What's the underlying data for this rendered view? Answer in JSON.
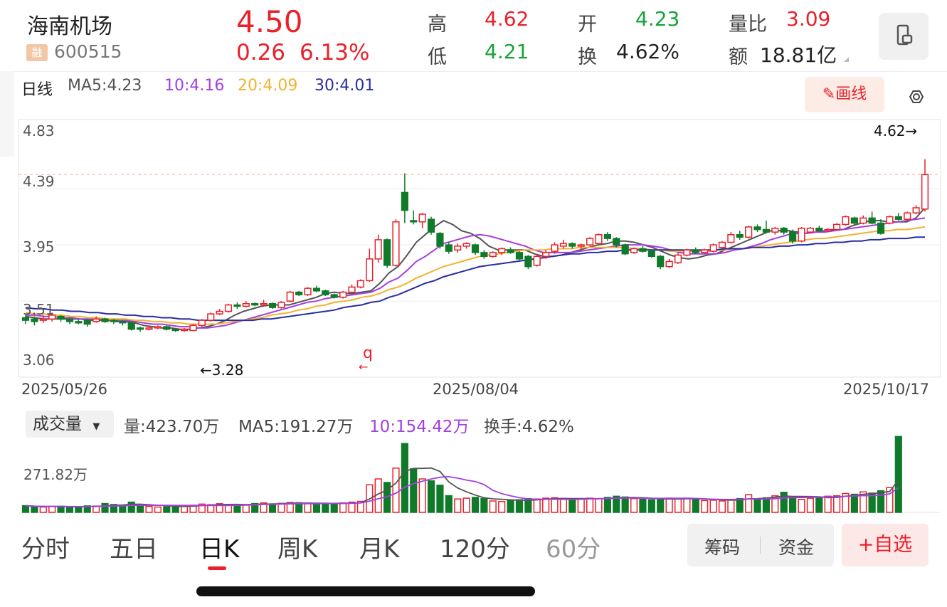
{
  "stock": {
    "name": "海南机场",
    "badge": "融",
    "code": "600515",
    "price": "4.50",
    "change": "0.26",
    "change_pct": "6.13%"
  },
  "quote": {
    "high_label": "高",
    "high": "4.62",
    "low_label": "低",
    "low": "4.21",
    "open_label": "开",
    "open": "4.23",
    "turnover_label": "换",
    "turnover": "4.62%",
    "vol_ratio_label": "量比",
    "vol_ratio": "3.09",
    "amount_label": "额",
    "amount": "18.81亿"
  },
  "ma": {
    "period": "日线",
    "ma5": "MA5:4.23",
    "ma10": "10:4.16",
    "ma20": "20:4.09",
    "ma30": "30:4.01",
    "colors": {
      "ma5": "#555555",
      "ma10": "#a43fe0",
      "ma20": "#f2b330",
      "ma30": "#2a2ea0"
    }
  },
  "draw_button": "画线",
  "price_axis": [
    "4.83",
    "4.39",
    "3.95",
    "3.51",
    "3.06"
  ],
  "annotations": {
    "max_label": "4.62→",
    "min_label": "←3.28",
    "q_marker": "q"
  },
  "dates": [
    "2025/05/26",
    "2025/08/04",
    "2025/10/17"
  ],
  "volume": {
    "selector": "成交量",
    "amount": "量:423.70万",
    "ma5": "MA5:191.27万",
    "ma10": "10:154.42万",
    "turnover": "换手:4.62%",
    "axis_label": "271.82万"
  },
  "tabs": [
    "分时",
    "五日",
    "日K",
    "周K",
    "月K",
    "120分",
    "60分"
  ],
  "buttons": {
    "chips": "筹码",
    "funds": "资金",
    "watchlist": "+自选"
  },
  "chart_data": {
    "type": "candlestick",
    "ylim": [
      3.06,
      4.83
    ],
    "x_ticks": [
      "2025/05/26",
      "2025/08/04",
      "2025/10/17"
    ],
    "candles": [
      {
        "o": 3.38,
        "c": 3.36,
        "h": 3.4,
        "l": 3.33
      },
      {
        "o": 3.37,
        "c": 3.35,
        "h": 3.39,
        "l": 3.32
      },
      {
        "o": 3.36,
        "c": 3.37,
        "h": 3.4,
        "l": 3.34
      },
      {
        "o": 3.37,
        "c": 3.4,
        "h": 3.42,
        "l": 3.35
      },
      {
        "o": 3.39,
        "c": 3.37,
        "h": 3.4,
        "l": 3.35
      },
      {
        "o": 3.37,
        "c": 3.35,
        "h": 3.38,
        "l": 3.33
      },
      {
        "o": 3.35,
        "c": 3.34,
        "h": 3.37,
        "l": 3.33
      },
      {
        "o": 3.36,
        "c": 3.33,
        "h": 3.37,
        "l": 3.31
      },
      {
        "o": 3.35,
        "c": 3.37,
        "h": 3.39,
        "l": 3.34
      },
      {
        "o": 3.37,
        "c": 3.35,
        "h": 3.38,
        "l": 3.34
      },
      {
        "o": 3.36,
        "c": 3.35,
        "h": 3.37,
        "l": 3.33
      },
      {
        "o": 3.35,
        "c": 3.34,
        "h": 3.36,
        "l": 3.32
      },
      {
        "o": 3.34,
        "c": 3.29,
        "h": 3.35,
        "l": 3.28
      },
      {
        "o": 3.3,
        "c": 3.29,
        "h": 3.31,
        "l": 3.27
      },
      {
        "o": 3.29,
        "c": 3.3,
        "h": 3.31,
        "l": 3.28
      },
      {
        "o": 3.3,
        "c": 3.31,
        "h": 3.32,
        "l": 3.29
      },
      {
        "o": 3.31,
        "c": 3.29,
        "h": 3.32,
        "l": 3.28
      },
      {
        "o": 3.29,
        "c": 3.28,
        "h": 3.3,
        "l": 3.27
      },
      {
        "o": 3.28,
        "c": 3.29,
        "h": 3.3,
        "l": 3.27
      },
      {
        "o": 3.28,
        "c": 3.32,
        "h": 3.33,
        "l": 3.28
      },
      {
        "o": 3.32,
        "c": 3.36,
        "h": 3.37,
        "l": 3.31
      },
      {
        "o": 3.36,
        "c": 3.41,
        "h": 3.42,
        "l": 3.35
      },
      {
        "o": 3.41,
        "c": 3.43,
        "h": 3.45,
        "l": 3.4
      },
      {
        "o": 3.43,
        "c": 3.48,
        "h": 3.49,
        "l": 3.42
      },
      {
        "o": 3.48,
        "c": 3.47,
        "h": 3.5,
        "l": 3.45
      },
      {
        "o": 3.47,
        "c": 3.49,
        "h": 3.51,
        "l": 3.46
      },
      {
        "o": 3.49,
        "c": 3.48,
        "h": 3.5,
        "l": 3.47
      },
      {
        "o": 3.48,
        "c": 3.49,
        "h": 3.52,
        "l": 3.47
      },
      {
        "o": 3.49,
        "c": 3.46,
        "h": 3.5,
        "l": 3.45
      },
      {
        "o": 3.46,
        "c": 3.5,
        "h": 3.51,
        "l": 3.45
      },
      {
        "o": 3.51,
        "c": 3.58,
        "h": 3.59,
        "l": 3.5
      },
      {
        "o": 3.58,
        "c": 3.56,
        "h": 3.59,
        "l": 3.55
      },
      {
        "o": 3.56,
        "c": 3.61,
        "h": 3.62,
        "l": 3.55
      },
      {
        "o": 3.61,
        "c": 3.59,
        "h": 3.63,
        "l": 3.58
      },
      {
        "o": 3.59,
        "c": 3.56,
        "h": 3.6,
        "l": 3.55
      },
      {
        "o": 3.56,
        "c": 3.54,
        "h": 3.57,
        "l": 3.53
      },
      {
        "o": 3.54,
        "c": 3.58,
        "h": 3.59,
        "l": 3.53
      },
      {
        "o": 3.58,
        "c": 3.62,
        "h": 3.64,
        "l": 3.57
      },
      {
        "o": 3.62,
        "c": 3.67,
        "h": 3.68,
        "l": 3.61
      },
      {
        "o": 3.67,
        "c": 3.84,
        "h": 3.92,
        "l": 3.66
      },
      {
        "o": 3.84,
        "c": 3.99,
        "h": 4.03,
        "l": 3.81
      },
      {
        "o": 3.99,
        "c": 3.79,
        "h": 4.0,
        "l": 3.77
      },
      {
        "o": 3.79,
        "c": 4.13,
        "h": 4.15,
        "l": 3.78
      },
      {
        "o": 4.36,
        "c": 4.22,
        "h": 4.51,
        "l": 4.12
      },
      {
        "o": 4.14,
        "c": 4.13,
        "h": 4.22,
        "l": 4.11
      },
      {
        "o": 4.13,
        "c": 4.19,
        "h": 4.2,
        "l": 4.08
      },
      {
        "o": 4.15,
        "c": 4.05,
        "h": 4.17,
        "l": 4.03
      },
      {
        "o": 4.04,
        "c": 3.94,
        "h": 4.05,
        "l": 3.92
      },
      {
        "o": 3.95,
        "c": 3.9,
        "h": 3.97,
        "l": 3.88
      },
      {
        "o": 3.91,
        "c": 3.94,
        "h": 3.96,
        "l": 3.89
      },
      {
        "o": 3.94,
        "c": 3.96,
        "h": 3.97,
        "l": 3.92
      },
      {
        "o": 3.95,
        "c": 3.89,
        "h": 3.96,
        "l": 3.87
      },
      {
        "o": 3.89,
        "c": 3.86,
        "h": 3.91,
        "l": 3.84
      },
      {
        "o": 3.86,
        "c": 3.89,
        "h": 3.9,
        "l": 3.85
      },
      {
        "o": 3.89,
        "c": 3.92,
        "h": 3.93,
        "l": 3.87
      },
      {
        "o": 3.91,
        "c": 3.89,
        "h": 3.93,
        "l": 3.88
      },
      {
        "o": 3.89,
        "c": 3.84,
        "h": 3.9,
        "l": 3.83
      },
      {
        "o": 3.86,
        "c": 3.78,
        "h": 3.87,
        "l": 3.76
      },
      {
        "o": 3.79,
        "c": 3.86,
        "h": 3.88,
        "l": 3.78
      },
      {
        "o": 3.86,
        "c": 3.89,
        "h": 3.91,
        "l": 3.84
      },
      {
        "o": 3.9,
        "c": 3.95,
        "h": 3.97,
        "l": 3.88
      },
      {
        "o": 3.94,
        "c": 3.96,
        "h": 3.99,
        "l": 3.92
      },
      {
        "o": 3.96,
        "c": 3.94,
        "h": 3.97,
        "l": 3.92
      },
      {
        "o": 3.94,
        "c": 3.95,
        "h": 3.96,
        "l": 3.91
      },
      {
        "o": 3.95,
        "c": 4.0,
        "h": 4.01,
        "l": 3.94
      },
      {
        "o": 3.96,
        "c": 4.03,
        "h": 4.04,
        "l": 3.95
      },
      {
        "o": 4.03,
        "c": 4.0,
        "h": 4.05,
        "l": 3.98
      },
      {
        "o": 4.0,
        "c": 3.95,
        "h": 4.01,
        "l": 3.93
      },
      {
        "o": 3.95,
        "c": 3.88,
        "h": 3.96,
        "l": 3.87
      },
      {
        "o": 3.89,
        "c": 3.92,
        "h": 3.93,
        "l": 3.88
      },
      {
        "o": 3.92,
        "c": 3.9,
        "h": 3.94,
        "l": 3.89
      },
      {
        "o": 3.9,
        "c": 3.86,
        "h": 3.91,
        "l": 3.85
      },
      {
        "o": 3.86,
        "c": 3.78,
        "h": 3.87,
        "l": 3.76
      },
      {
        "o": 3.78,
        "c": 3.82,
        "h": 3.84,
        "l": 3.77
      },
      {
        "o": 3.81,
        "c": 3.87,
        "h": 3.89,
        "l": 3.8
      },
      {
        "o": 3.87,
        "c": 3.91,
        "h": 3.92,
        "l": 3.86
      },
      {
        "o": 3.91,
        "c": 3.89,
        "h": 3.93,
        "l": 3.88
      },
      {
        "o": 3.89,
        "c": 3.91,
        "h": 3.92,
        "l": 3.88
      },
      {
        "o": 3.9,
        "c": 3.95,
        "h": 3.96,
        "l": 3.89
      },
      {
        "o": 3.93,
        "c": 3.97,
        "h": 3.98,
        "l": 3.92
      },
      {
        "o": 3.97,
        "c": 4.03,
        "h": 4.05,
        "l": 3.96
      },
      {
        "o": 4.03,
        "c": 4.01,
        "h": 4.06,
        "l": 3.99
      },
      {
        "o": 4.01,
        "c": 4.09,
        "h": 4.1,
        "l": 4.0
      },
      {
        "o": 4.09,
        "c": 4.07,
        "h": 4.11,
        "l": 4.05
      },
      {
        "o": 4.07,
        "c": 4.05,
        "h": 4.14,
        "l": 4.04
      },
      {
        "o": 4.05,
        "c": 4.08,
        "h": 4.09,
        "l": 4.03
      },
      {
        "o": 4.08,
        "c": 4.05,
        "h": 4.09,
        "l": 4.03
      },
      {
        "o": 4.05,
        "c": 3.98,
        "h": 4.07,
        "l": 3.96
      },
      {
        "o": 3.98,
        "c": 4.08,
        "h": 4.09,
        "l": 3.97
      },
      {
        "o": 4.05,
        "c": 4.08,
        "h": 4.09,
        "l": 4.04
      },
      {
        "o": 4.08,
        "c": 4.06,
        "h": 4.1,
        "l": 4.05
      },
      {
        "o": 4.06,
        "c": 4.07,
        "h": 4.08,
        "l": 4.05
      },
      {
        "o": 4.07,
        "c": 4.11,
        "h": 4.12,
        "l": 4.06
      },
      {
        "o": 4.11,
        "c": 4.17,
        "h": 4.18,
        "l": 4.1
      },
      {
        "o": 4.16,
        "c": 4.12,
        "h": 4.17,
        "l": 4.1
      },
      {
        "o": 4.12,
        "c": 4.16,
        "h": 4.18,
        "l": 4.11
      },
      {
        "o": 4.16,
        "c": 4.12,
        "h": 4.21,
        "l": 4.11
      },
      {
        "o": 4.12,
        "c": 4.04,
        "h": 4.15,
        "l": 4.03
      },
      {
        "o": 4.12,
        "c": 4.17,
        "h": 4.18,
        "l": 4.11
      },
      {
        "o": 4.17,
        "c": 4.15,
        "h": 4.2,
        "l": 4.14
      },
      {
        "o": 4.15,
        "c": 4.2,
        "h": 4.21,
        "l": 4.14
      },
      {
        "o": 4.2,
        "c": 4.24,
        "h": 4.26,
        "l": 4.19
      },
      {
        "o": 4.23,
        "c": 4.5,
        "h": 4.62,
        "l": 4.21
      }
    ],
    "ma_series": {
      "MA5": [
        3.39,
        3.38,
        3.37,
        3.37,
        3.37,
        3.37,
        3.37,
        3.36,
        3.36,
        3.36,
        3.35,
        3.35,
        3.34,
        3.32,
        3.31,
        3.3,
        3.3,
        3.29,
        3.29,
        3.3,
        3.31,
        3.33,
        3.36,
        3.4,
        3.43,
        3.45,
        3.47,
        3.48,
        3.48,
        3.48,
        3.5,
        3.52,
        3.54,
        3.57,
        3.58,
        3.57,
        3.57,
        3.58,
        3.59,
        3.65,
        3.73,
        3.78,
        3.87,
        3.97,
        4.03,
        4.09,
        4.14,
        4.11,
        4.06,
        4.04,
        4.0,
        3.94,
        3.91,
        3.91,
        3.91,
        3.91,
        3.88,
        3.86,
        3.86,
        3.87,
        3.89,
        3.91,
        3.93,
        3.95,
        3.96,
        3.98,
        3.98,
        3.97,
        3.95,
        3.93,
        3.9,
        3.87,
        3.85,
        3.84,
        3.85,
        3.87,
        3.88,
        3.91,
        3.94,
        3.97,
        4.0,
        4.03,
        4.06,
        4.06,
        4.06,
        4.05,
        4.04,
        4.05,
        4.06,
        4.07,
        4.07,
        4.1,
        4.12,
        4.14,
        4.14,
        4.13,
        4.13,
        4.13,
        4.16,
        4.24
      ],
      "MA10": [
        3.4,
        3.4,
        3.39,
        3.39,
        3.38,
        3.38,
        3.37,
        3.37,
        3.37,
        3.36,
        3.36,
        3.36,
        3.35,
        3.34,
        3.33,
        3.33,
        3.32,
        3.31,
        3.31,
        3.3,
        3.3,
        3.31,
        3.32,
        3.34,
        3.36,
        3.38,
        3.4,
        3.42,
        3.44,
        3.46,
        3.48,
        3.5,
        3.51,
        3.53,
        3.54,
        3.55,
        3.56,
        3.57,
        3.58,
        3.61,
        3.66,
        3.69,
        3.75,
        3.82,
        3.86,
        3.91,
        3.96,
        3.98,
        4.0,
        4.02,
        4.03,
        4.02,
        4.0,
        3.98,
        3.96,
        3.94,
        3.91,
        3.89,
        3.89,
        3.89,
        3.89,
        3.9,
        3.91,
        3.92,
        3.93,
        3.94,
        3.95,
        3.95,
        3.95,
        3.94,
        3.93,
        3.91,
        3.89,
        3.88,
        3.88,
        3.88,
        3.88,
        3.89,
        3.91,
        3.92,
        3.94,
        3.96,
        3.99,
        4.01,
        4.03,
        4.04,
        4.04,
        4.05,
        4.05,
        4.06,
        4.07,
        4.08,
        4.09,
        4.1,
        4.11,
        4.12,
        4.13,
        4.14,
        4.15,
        4.16
      ],
      "MA20": [
        3.42,
        3.41,
        3.41,
        3.4,
        3.4,
        3.39,
        3.39,
        3.38,
        3.38,
        3.37,
        3.37,
        3.37,
        3.36,
        3.36,
        3.35,
        3.35,
        3.34,
        3.34,
        3.33,
        3.33,
        3.33,
        3.33,
        3.34,
        3.35,
        3.36,
        3.37,
        3.38,
        3.4,
        3.41,
        3.42,
        3.44,
        3.45,
        3.47,
        3.48,
        3.5,
        3.51,
        3.52,
        3.54,
        3.55,
        3.57,
        3.6,
        3.62,
        3.65,
        3.69,
        3.72,
        3.75,
        3.78,
        3.8,
        3.82,
        3.84,
        3.86,
        3.87,
        3.88,
        3.89,
        3.9,
        3.91,
        3.91,
        3.91,
        3.92,
        3.92,
        3.92,
        3.93,
        3.93,
        3.93,
        3.93,
        3.93,
        3.93,
        3.92,
        3.92,
        3.91,
        3.91,
        3.9,
        3.9,
        3.9,
        3.9,
        3.9,
        3.91,
        3.91,
        3.92,
        3.92,
        3.93,
        3.94,
        3.95,
        3.96,
        3.97,
        3.98,
        3.99,
        4.0,
        4.0,
        4.01,
        4.02,
        4.03,
        4.04,
        4.05,
        4.06,
        4.06,
        4.07,
        4.07,
        4.08,
        4.09
      ],
      "MA30": [
        3.46,
        3.45,
        3.45,
        3.44,
        3.44,
        3.43,
        3.43,
        3.42,
        3.42,
        3.41,
        3.41,
        3.4,
        3.4,
        3.39,
        3.39,
        3.38,
        3.38,
        3.37,
        3.37,
        3.36,
        3.36,
        3.36,
        3.36,
        3.36,
        3.36,
        3.36,
        3.37,
        3.37,
        3.38,
        3.39,
        3.4,
        3.41,
        3.42,
        3.43,
        3.44,
        3.46,
        3.47,
        3.48,
        3.5,
        3.51,
        3.54,
        3.56,
        3.59,
        3.62,
        3.65,
        3.67,
        3.7,
        3.72,
        3.74,
        3.76,
        3.78,
        3.79,
        3.8,
        3.81,
        3.82,
        3.83,
        3.84,
        3.85,
        3.86,
        3.87,
        3.88,
        3.88,
        3.89,
        3.89,
        3.9,
        3.9,
        3.91,
        3.91,
        3.91,
        3.91,
        3.91,
        3.91,
        3.91,
        3.91,
        3.91,
        3.91,
        3.91,
        3.92,
        3.92,
        3.92,
        3.93,
        3.93,
        3.93,
        3.94,
        3.94,
        3.95,
        3.95,
        3.96,
        3.96,
        3.97,
        3.97,
        3.98,
        3.98,
        3.99,
        3.99,
        4.0,
        4.0,
        4.0,
        4.01,
        4.01
      ]
    },
    "volumes": [
      34,
      29,
      27,
      30,
      31,
      26,
      28,
      33,
      32,
      45,
      40,
      36,
      52,
      35,
      30,
      27,
      29,
      31,
      34,
      36,
      42,
      39,
      44,
      40,
      38,
      37,
      45,
      48,
      43,
      46,
      50,
      49,
      47,
      42,
      45,
      44,
      48,
      52,
      56,
      140,
      170,
      152,
      225,
      350,
      222,
      170,
      160,
      138,
      85,
      68,
      72,
      76,
      70,
      58,
      55,
      60,
      64,
      70,
      68,
      72,
      74,
      70,
      66,
      68,
      72,
      70,
      76,
      82,
      78,
      70,
      66,
      64,
      68,
      72,
      70,
      72,
      66,
      60,
      62,
      58,
      64,
      70,
      90,
      66,
      74,
      84,
      102,
      78,
      66,
      72,
      76,
      82,
      84,
      96,
      92,
      104,
      98,
      110,
      126,
      386
    ],
    "volume_ma5": [],
    "volume_ylim": [
      0,
      380
    ]
  }
}
